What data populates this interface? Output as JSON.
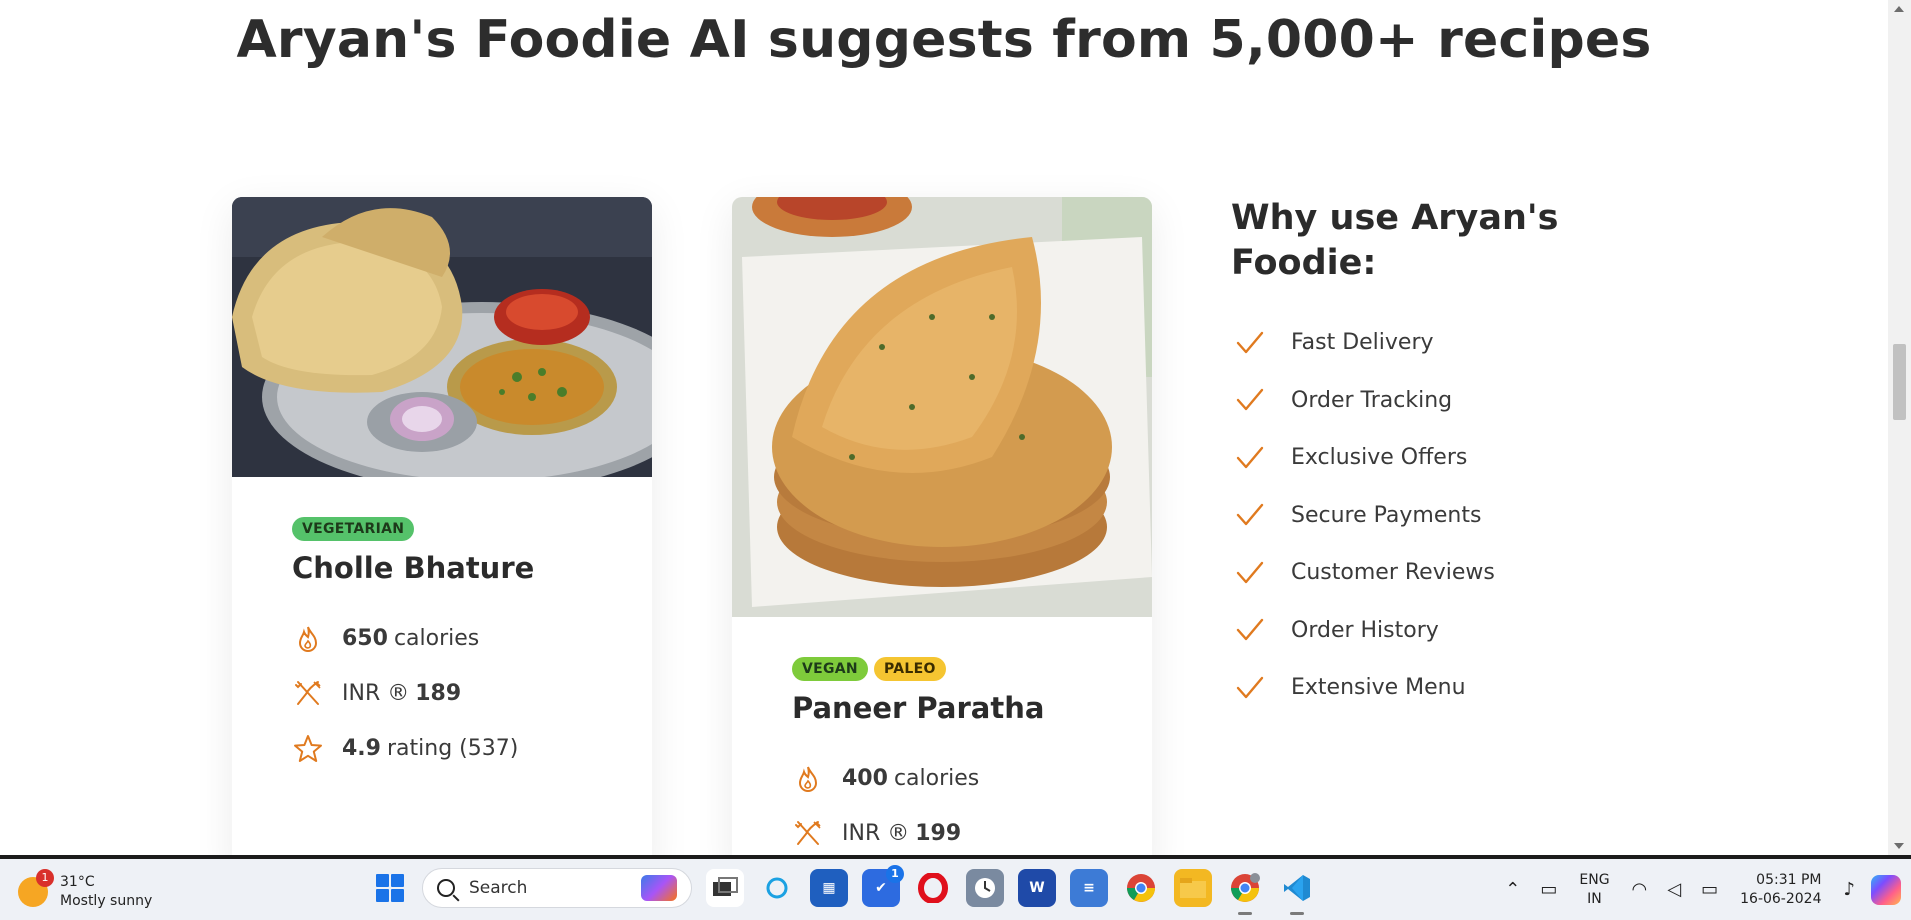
{
  "headline": "Aryan's Foodie AI suggests from 5,000+ recipes",
  "cards": [
    {
      "tags": [
        "VEGETARIAN"
      ],
      "name": "Cholle Bhature",
      "calories_value": "650",
      "calories_unit": "calories",
      "price_prefix": "INR ®",
      "price_value": "189",
      "rating_value": "4.9",
      "rating_text": "rating (537)"
    },
    {
      "tags": [
        "VEGAN",
        "PALEO"
      ],
      "name": "Paneer Paratha",
      "calories_value": "400",
      "calories_unit": "calories",
      "price_prefix": "INR ®",
      "price_value": "199"
    }
  ],
  "why": {
    "title": "Why use Aryan's Foodie:",
    "items": [
      "Fast Delivery",
      "Order Tracking",
      "Exclusive Offers",
      "Secure Payments",
      "Customer Reviews",
      "Order History",
      "Extensive Menu"
    ]
  },
  "colors": {
    "accent": "#e07a1f",
    "tag_vegetarian": "#55c26a",
    "tag_vegan": "#7ecb3b",
    "tag_paleo": "#f5c531"
  },
  "taskbar": {
    "weather_temp": "31°C",
    "weather_desc": "Mostly sunny",
    "weather_badge": "1",
    "search_placeholder": "Search",
    "todo_badge": "1",
    "lang_line1": "ENG",
    "lang_line2": "IN",
    "time": "05:31 PM",
    "date": "16-06-2024",
    "apps": [
      "task-view-icon",
      "cortana-icon",
      "store-icon",
      "todo-icon",
      "opera-icon",
      "clock-icon",
      "word-icon",
      "notepad-icon",
      "chrome-icon",
      "file-explorer-icon",
      "chrome-profile-icon",
      "vscode-icon"
    ]
  }
}
